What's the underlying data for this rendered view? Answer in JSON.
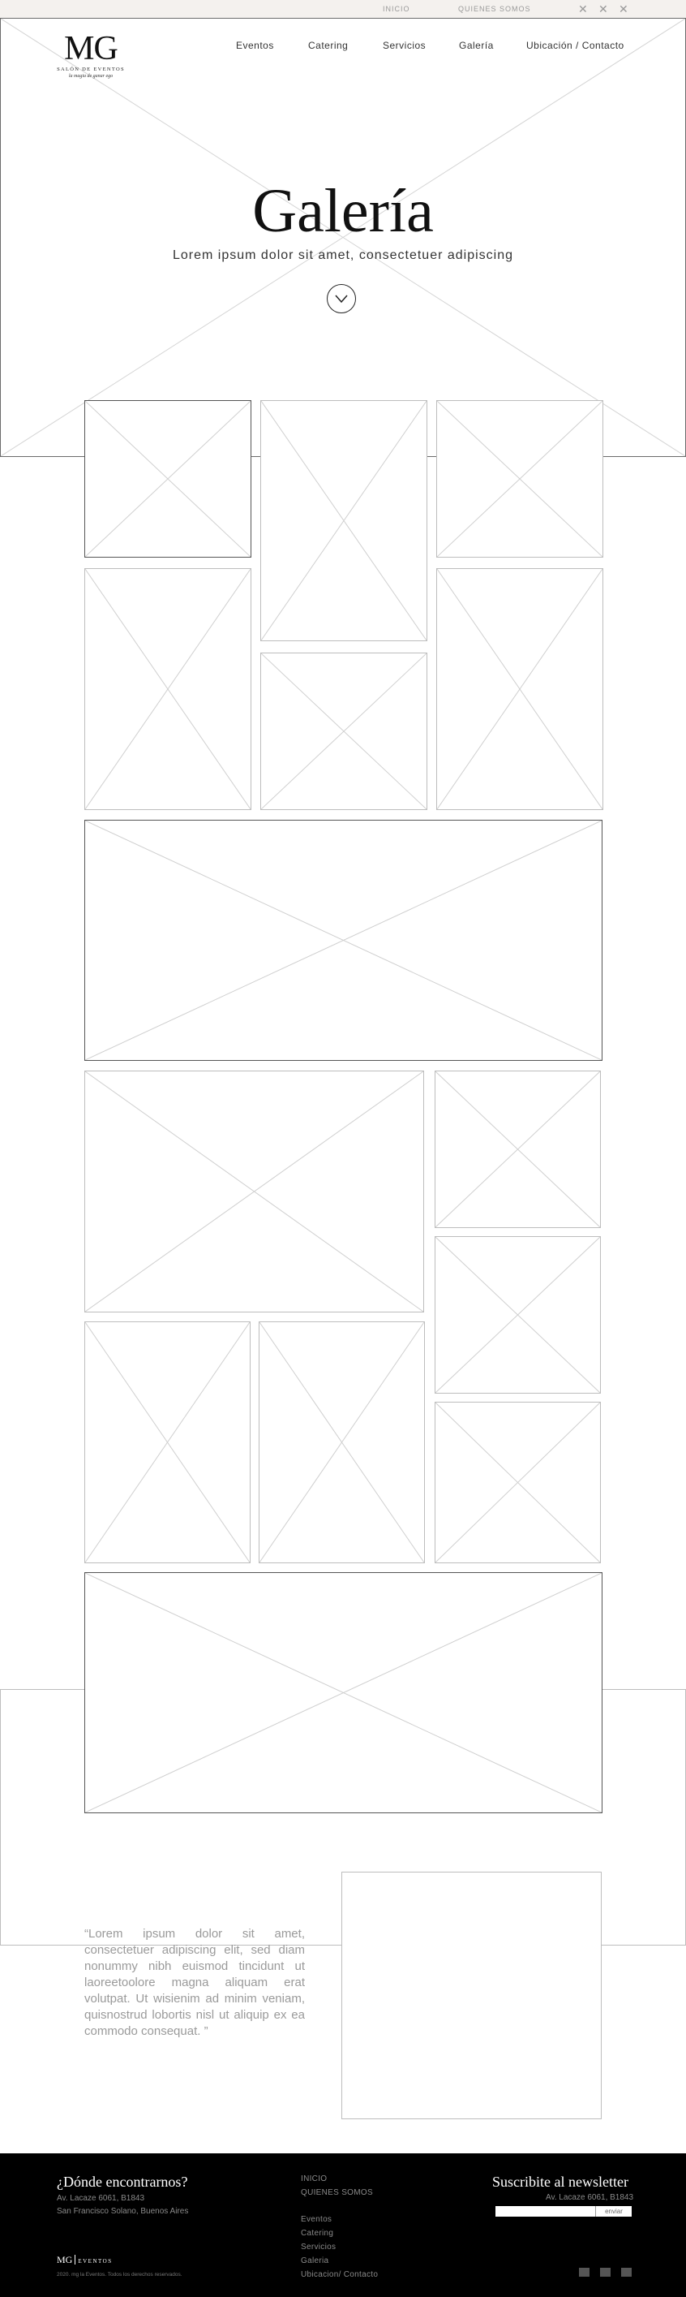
{
  "topbar": {
    "links": [
      "INICIO",
      "QUIENES SOMOS"
    ],
    "icons": [
      "close-icon",
      "close-icon",
      "close-icon"
    ]
  },
  "brand": {
    "mark": "MG",
    "subtitle": "SALÓN DE EVENTOS",
    "tagline": "la magia de ganar ego"
  },
  "nav": {
    "items": [
      "Eventos",
      "Catering",
      "Servicios",
      "Galería",
      "Ubicación / Contacto"
    ]
  },
  "hero": {
    "title": "Galería",
    "subtitle": "Lorem ipsum dolor sit amet, consectetuer adipiscing",
    "scroll_icon": "chevron-down-icon"
  },
  "testimonial": {
    "quote": "“Lorem ipsum dolor sit amet, consectetuer adipiscing elit, sed diam nonummy nibh euismod tincidunt ut laoreetoolore magna aliquam erat volutpat. Ut wisienim ad minim veniam, quisnostrud lobortis nisl ut aliquip ex ea commodo consequat. ”"
  },
  "footer": {
    "find_us_title": "¿Dónde encontrarnos?",
    "address_line1": "Av. Lacaze 6061, B1843",
    "address_line2": "San Francisco Solano, Buenos Aires",
    "links": [
      "INICIO",
      "QUIENES SOMOS",
      "Eventos",
      "Catering",
      "Servicios",
      "Galeria",
      "Ubicacion/ Contacto"
    ],
    "newsletter_title": "Suscribite al newsletter",
    "newsletter_address": "Av. Lacaze 6061, B1843",
    "newsletter_button": "enviar",
    "logo_mark": "MG",
    "logo_text": "EVENTOS",
    "copyright": "2020. mg la Eventos. Todos los derechos reservados.",
    "social_icons": [
      "social-icon",
      "social-icon",
      "social-icon"
    ]
  },
  "colors": {
    "topbar_bg": "#f4f1ee",
    "footer_bg": "#000000",
    "placeholder_stroke": "#cfcfcf",
    "text_muted": "#9a9a9a"
  }
}
